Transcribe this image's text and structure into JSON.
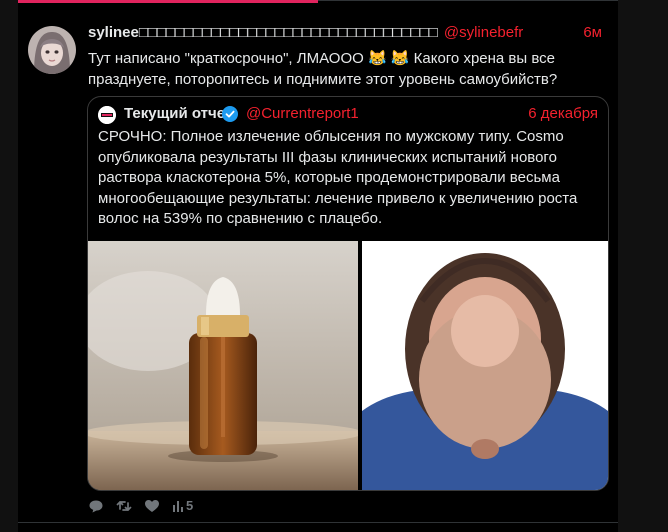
{
  "tweet": {
    "author_name": "sylinee□□□□□□□□□□□□□□□□□□□□□□□□□□□□□□□□□",
    "author_handle": "@sylinebefr",
    "time": "6м",
    "text": "Тут написано \"краткосрочно\", ЛМАООО 😹 😹 Какого хрена вы все празднуете, поторопитесь и поднимите этот уровень самоубийств?",
    "avatar_icon": "avatar-photo"
  },
  "quote": {
    "author_name": "Текущий отчет",
    "author_handle": "@Currentreport1",
    "date": "6 декабря",
    "verified_icon": "verified-badge-icon",
    "logo_icon": "outlet-logo",
    "text": "СРОЧНО: Полное излечение облысения по мужскому типу. Cosmo опубликовала результаты III фазы клинических испытаний нового раствора класкотерона 5%, которые продемонстрировали весьма многообещающие результаты: лечение привело к увеличению роста волос на 539% по сравнению с плацебо.",
    "media": [
      "serum-dropper-bottle-photo",
      "balding-scalp-photo"
    ]
  },
  "actions": {
    "reply_icon": "reply-icon",
    "retweet_icon": "retweet-icon",
    "like_icon": "heart-icon",
    "views_icon": "views-chart-icon",
    "views_count": "5"
  },
  "colors": {
    "background": "#000000",
    "text": "#e7e9ea",
    "accent": "#f4212e",
    "muted": "#71767b",
    "border": "#3a3a3a",
    "verified": "#1d9bf0"
  }
}
